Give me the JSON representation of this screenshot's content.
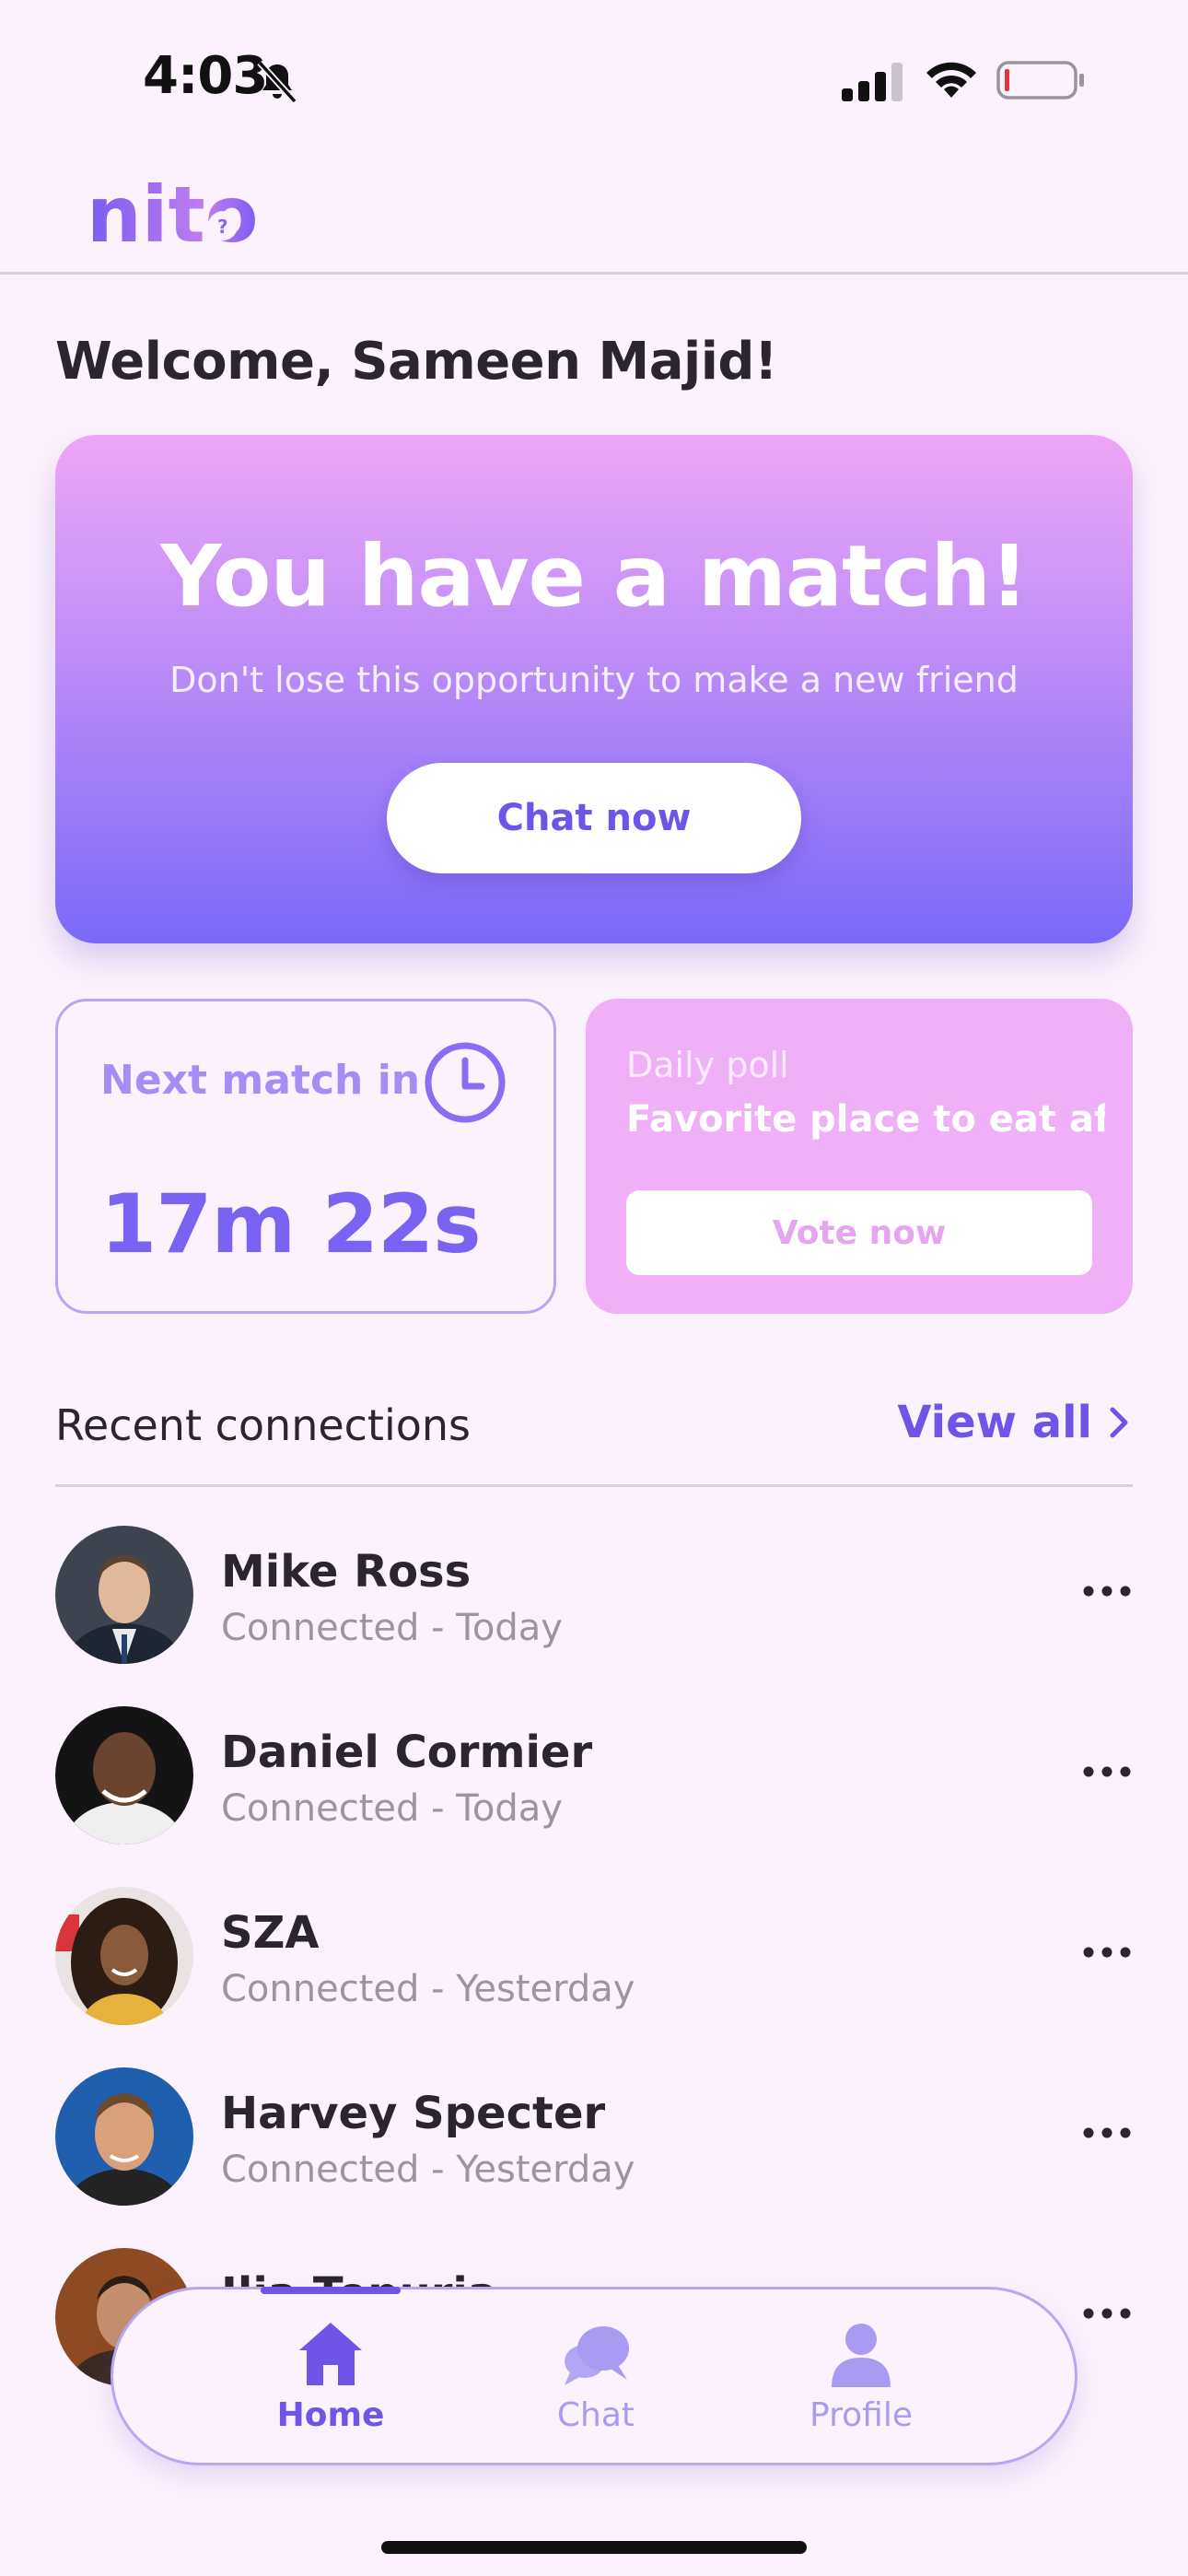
{
  "status_bar": {
    "time": "4:03"
  },
  "app": {
    "logo_text": "nito"
  },
  "welcome": "Welcome, Sameen Majid!",
  "match_card": {
    "title": "You have a match!",
    "subtitle": "Don't lose this opportunity to make a new friend",
    "button_label": "Chat now"
  },
  "next_match": {
    "label": "Next match in",
    "countdown": "17m 22s"
  },
  "daily_poll": {
    "label": "Daily poll",
    "question": "Favorite place to eat aft...",
    "button_label": "Vote now"
  },
  "recent_connections": {
    "title": "Recent connections",
    "view_all_label": "View all",
    "items": [
      {
        "name": "Mike Ross",
        "status": "Connected - Today"
      },
      {
        "name": "Daniel Cormier",
        "status": "Connected - Today"
      },
      {
        "name": "SZA",
        "status": "Connected - Yesterday"
      },
      {
        "name": "Harvey Specter",
        "status": "Connected - Yesterday"
      },
      {
        "name": "Ilia Topuria",
        "status": ""
      }
    ]
  },
  "bottom_nav": {
    "items": [
      {
        "label": "Home",
        "icon": "home-icon",
        "active": true
      },
      {
        "label": "Chat",
        "icon": "chat-icon",
        "active": false
      },
      {
        "label": "Profile",
        "icon": "profile-icon",
        "active": false
      }
    ]
  },
  "colors": {
    "background": "#fcf2fd",
    "accent": "#6e55e8",
    "accent_light": "#a58df6",
    "poll_pink": "#efb0f8"
  }
}
